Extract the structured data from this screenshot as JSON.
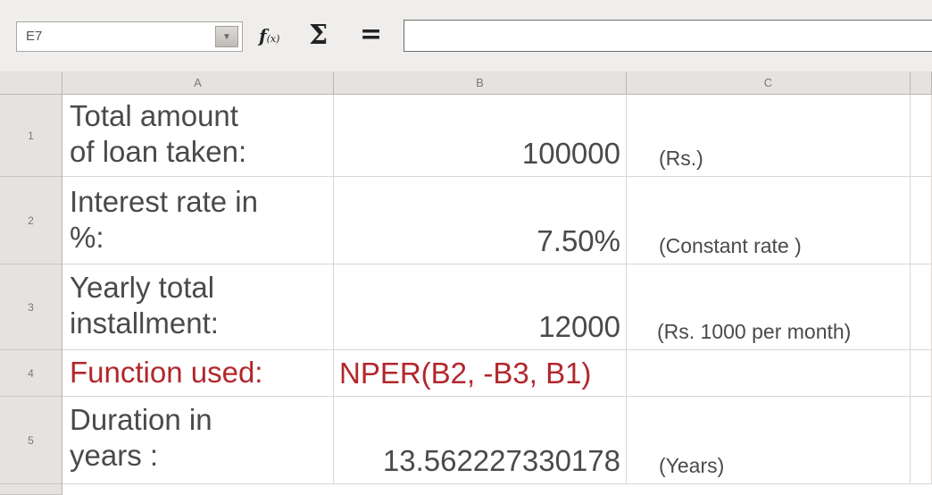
{
  "formula_bar": {
    "cell_reference": "E7",
    "dropdown_glyph": "▼",
    "function_wizard_icon": "f(x)",
    "sum_icon": "Σ",
    "formula_icon": "=",
    "input_value": ""
  },
  "columns": [
    "A",
    "B",
    "C"
  ],
  "rows": [
    {
      "number": "1",
      "a": "Total amount\nof loan taken:",
      "b": "100000",
      "c": "(Rs.)"
    },
    {
      "number": "2",
      "a": "Interest rate in\n%:",
      "b": "7.50%",
      "c": "(Constant rate )"
    },
    {
      "number": "3",
      "a": "Yearly total\ninstallment:",
      "b": "12000",
      "c": "(Rs. 1000 per month)"
    },
    {
      "number": "4",
      "a": "Function used:",
      "b": "NPER(B2, -B3, B1)",
      "c": ""
    },
    {
      "number": "5",
      "a": "Duration in\nyears :",
      "b": "13.562227330178",
      "c": "(Years)"
    }
  ],
  "colors": {
    "highlight_text": "#b2272c",
    "normal_text": "#4a4a4a"
  }
}
